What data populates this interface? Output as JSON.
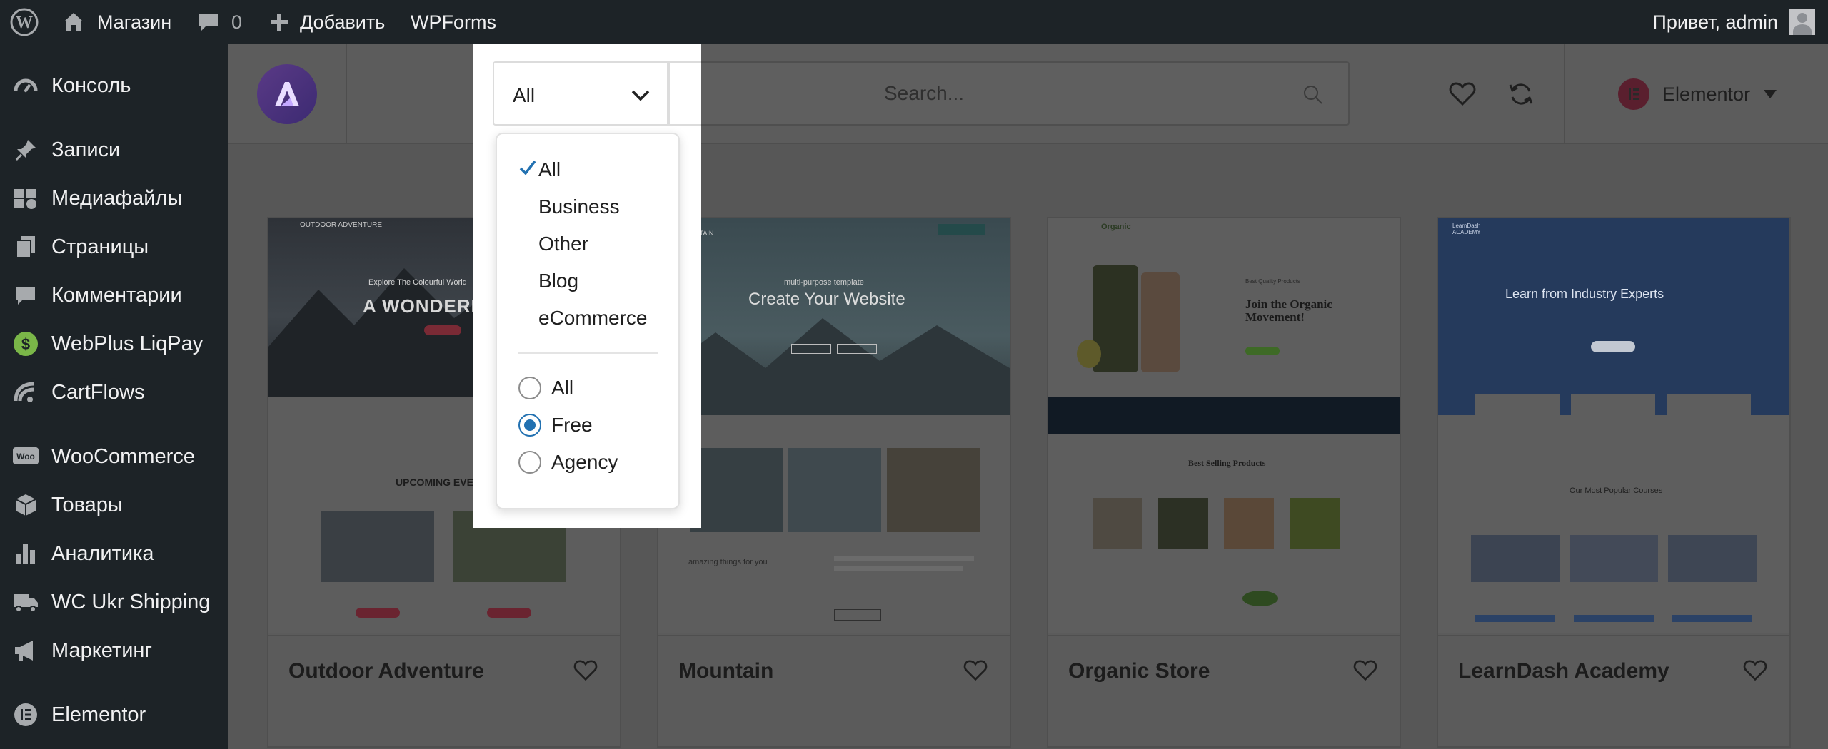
{
  "admin_bar": {
    "site_name": "Магазин",
    "comments_count": "0",
    "add_new": "Добавить",
    "wpforms": "WPForms",
    "greeting": "Привет, admin"
  },
  "sidebar": {
    "items": [
      {
        "label": "Консоль",
        "icon": "dashboard-icon"
      },
      {
        "label": "Записи",
        "icon": "pin-icon"
      },
      {
        "label": "Медиафайлы",
        "icon": "media-icon"
      },
      {
        "label": "Страницы",
        "icon": "pages-icon"
      },
      {
        "label": "Комментарии",
        "icon": "comment-icon"
      },
      {
        "label": "WebPlus LiqPay",
        "icon": "liqpay-icon"
      },
      {
        "label": "CartFlows",
        "icon": "cartflows-icon"
      },
      {
        "label": "WooCommerce",
        "icon": "woocommerce-icon"
      },
      {
        "label": "Товары",
        "icon": "products-icon"
      },
      {
        "label": "Аналитика",
        "icon": "analytics-icon"
      },
      {
        "label": "WC Ukr Shipping",
        "icon": "shipping-icon"
      },
      {
        "label": "Маркетинг",
        "icon": "marketing-icon"
      },
      {
        "label": "Elementor",
        "icon": "elementor-icon"
      }
    ]
  },
  "toolbar": {
    "category_selected": "All",
    "search_placeholder": "Search...",
    "builder_label": "Elementor"
  },
  "dropdown": {
    "categories": [
      "All",
      "Business",
      "Other",
      "Blog",
      "eCommerce"
    ],
    "selected_category": "All",
    "types": [
      "All",
      "Free",
      "Agency"
    ],
    "selected_type": "Free"
  },
  "templates": [
    {
      "name": "Outdoor Adventure",
      "thumb_heading": "A WONDERFUL G",
      "thumb_sub": "Explore The Colourful World",
      "thumb_section": "UPCOMING EVENTS",
      "thumb_brand": "OUTDOOR ADVENTURE"
    },
    {
      "name": "Mountain",
      "thumb_heading": "Create Your Website",
      "thumb_sub": "multi-purpose template",
      "thumb_section": "amazing things for you",
      "thumb_brand": "MOUNTAIN"
    },
    {
      "name": "Organic Store",
      "thumb_heading": "Join the Organic Movement!",
      "thumb_sub": "Best Quality Products",
      "thumb_section": "Best Selling Products",
      "thumb_brand": "Organic"
    },
    {
      "name": "LearnDash Academy",
      "thumb_heading": "Learn from Industry Experts",
      "thumb_sub": "",
      "thumb_section": "Our Most Popular Courses",
      "thumb_brand": "LearnDash ACADEMY"
    }
  ],
  "colors": {
    "admin_bg": "#1d2327",
    "overlay": "#575757",
    "accent": "#2271b1",
    "logo": "#4b2f7d"
  }
}
